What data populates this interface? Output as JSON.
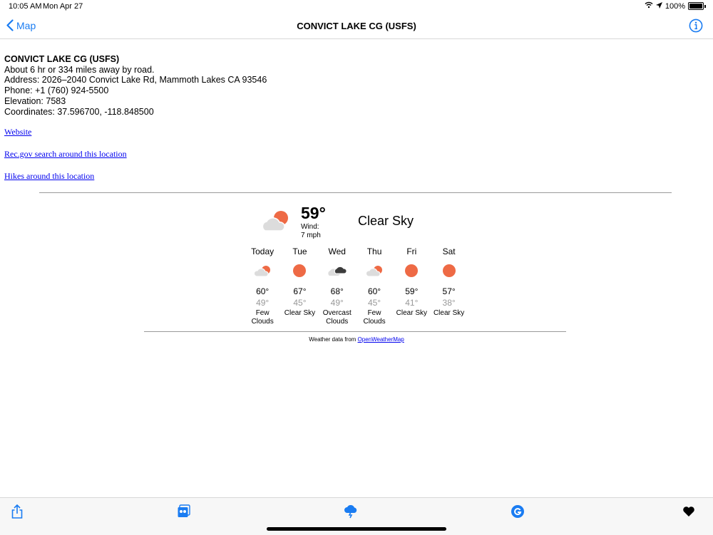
{
  "status": {
    "time": "10:05 AM",
    "date": "Mon Apr 27",
    "battery": "100%"
  },
  "nav": {
    "back_label": "Map",
    "title": "CONVICT LAKE CG (USFS)"
  },
  "details": {
    "name": "CONVICT LAKE CG (USFS)",
    "distance": "About 6 hr or 334 miles away by road.",
    "address": "Address: 2026–2040 Convict Lake Rd, Mammoth Lakes CA 93546",
    "phone": "Phone: +1 (760) 924-5500",
    "elevation": "Elevation: 7583",
    "coordinates": "Coordinates: 37.596700, -118.848500"
  },
  "links": {
    "website": "Website",
    "recgov": "Rec.gov search around this location",
    "hikes": "Hikes around this location"
  },
  "weather": {
    "current_temp": "59°",
    "wind_label": "Wind:",
    "wind_value": "7 mph",
    "condition": "Clear Sky",
    "current_icon": "few-clouds-icon",
    "forecast": [
      {
        "day": "Today",
        "icon": "few-clouds-icon",
        "hi": "60°",
        "lo": "49°",
        "cond": "Few Clouds"
      },
      {
        "day": "Tue",
        "icon": "clear-sky-icon",
        "hi": "67°",
        "lo": "45°",
        "cond": "Clear Sky"
      },
      {
        "day": "Wed",
        "icon": "overcast-clouds-icon",
        "hi": "68°",
        "lo": "49°",
        "cond": "Overcast Clouds"
      },
      {
        "day": "Thu",
        "icon": "few-clouds-icon",
        "hi": "60°",
        "lo": "45°",
        "cond": "Few Clouds"
      },
      {
        "day": "Fri",
        "icon": "clear-sky-icon",
        "hi": "59°",
        "lo": "41°",
        "cond": "Clear Sky"
      },
      {
        "day": "Sat",
        "icon": "clear-sky-icon",
        "hi": "57°",
        "lo": "38°",
        "cond": "Clear Sky"
      }
    ],
    "credit_prefix": "Weather data from ",
    "credit_link": "OpenWeatherMap"
  },
  "toolbar": [
    "share-icon",
    "photos-icon",
    "weather-icon",
    "google-icon",
    "heart-icon"
  ],
  "colors": {
    "accent": "#1a7cf2",
    "sun": "#ee6a45",
    "link": "#0000ee"
  }
}
